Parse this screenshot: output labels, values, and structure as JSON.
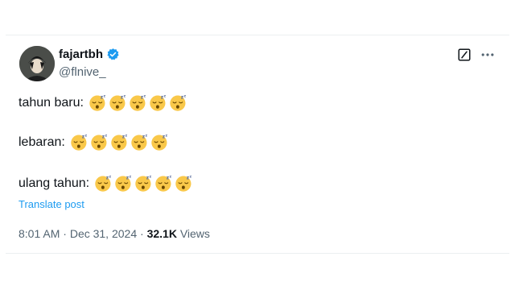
{
  "post": {
    "author": {
      "display_name": "fajartbh",
      "handle": "@flnive_",
      "verified": true
    },
    "lines": [
      {
        "text": "tahun baru:",
        "emoji": "sleeping-face",
        "emoji_count": 5
      },
      {
        "text": "lebaran:",
        "emoji": "sleeping-face",
        "emoji_count": 5
      },
      {
        "text": "ulang tahun:",
        "emoji": "sleeping-face",
        "emoji_count": 5
      }
    ],
    "translate_label": "Translate post",
    "time": "8:01 AM",
    "separator": "·",
    "date": "Dec 31, 2024",
    "views_count": "32.1K",
    "views_label": "Views"
  },
  "icons": {
    "verified": "verified-badge-icon",
    "grok": "grok-icon",
    "more": "more-options-icon"
  },
  "colors": {
    "text": "#0f1419",
    "secondary": "#536471",
    "link": "#1d9bf0",
    "verified": "#1d9bf0",
    "emoji_face": "#f9c84a"
  }
}
